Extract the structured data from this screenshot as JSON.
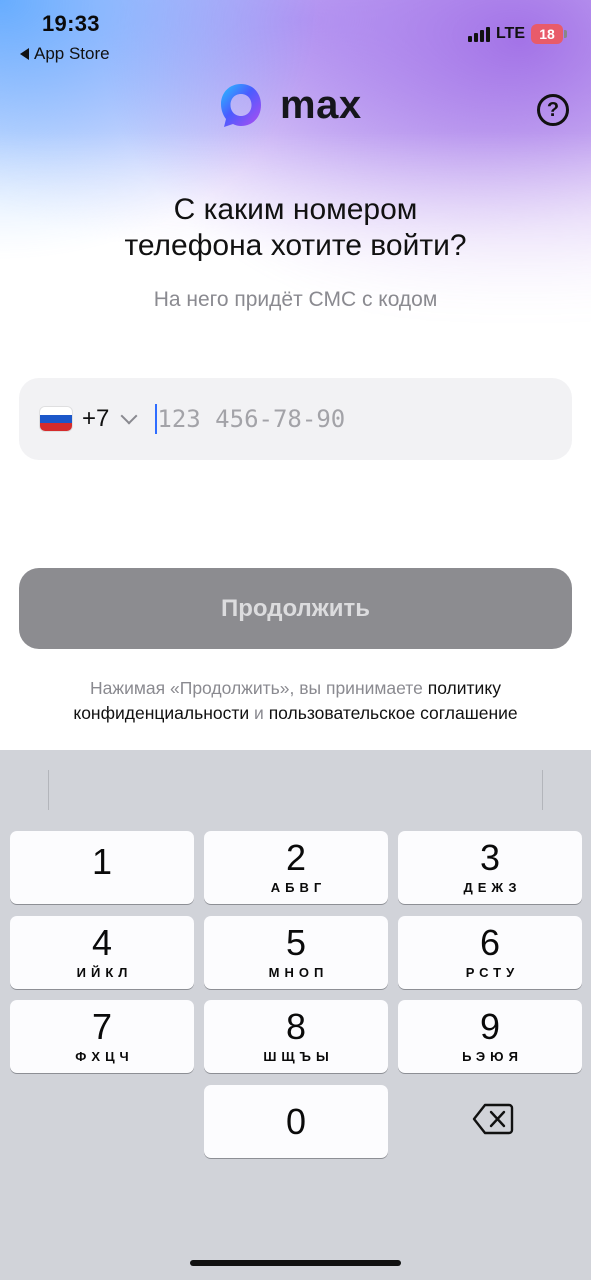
{
  "status_bar": {
    "time": "19:33",
    "back_label": "App Store",
    "network": "LTE",
    "battery": "18"
  },
  "header": {
    "logo_text": "max",
    "help_icon": "question-circle-icon"
  },
  "main": {
    "title_line1": "С каким номером",
    "title_line2": "телефона хотите войти?",
    "subtitle": "На него придёт СМС с кодом",
    "phone": {
      "country_code": "+7",
      "flag": "russia-flag-icon",
      "placeholder": "123 456-78-90",
      "value": ""
    },
    "continue_label": "Продолжить",
    "terms": {
      "prefix": "Нажимая «Продолжить», вы принимаете ",
      "privacy_part1": "политику",
      "privacy_part2": "конфиденциальности",
      "conjunction": " и ",
      "agreement": "пользовательское соглашение"
    }
  },
  "keyboard": {
    "keys": [
      {
        "digit": "1",
        "letters": ""
      },
      {
        "digit": "2",
        "letters": "АБВГ"
      },
      {
        "digit": "3",
        "letters": "ДЕЖЗ"
      },
      {
        "digit": "4",
        "letters": "ИЙКЛ"
      },
      {
        "digit": "5",
        "letters": "МНОП"
      },
      {
        "digit": "6",
        "letters": "РСТУ"
      },
      {
        "digit": "7",
        "letters": "ФХЦЧ"
      },
      {
        "digit": "8",
        "letters": "ШЩЪЫ"
      },
      {
        "digit": "9",
        "letters": "ЬЭЮЯ"
      },
      {
        "digit": "0",
        "letters": ""
      }
    ],
    "backspace_icon": "backspace-icon"
  },
  "colors": {
    "accent_caret": "#2f6dff",
    "button_disabled": "#8c8c90",
    "muted_text": "#8a8a90"
  }
}
